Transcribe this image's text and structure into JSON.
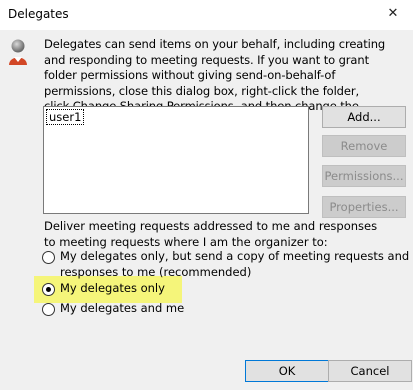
{
  "dialog": {
    "title": "Delegates",
    "close_glyph": "✕"
  },
  "intro_text": "Delegates can send items on your behalf, including creating and responding to meeting requests. If you want to grant folder permissions without giving send-on-behalf-of permissions, close this dialog box, right-click the folder, click Change Sharing Permissions, and then change the options on the Permissions tab.",
  "delegates": [
    "user1"
  ],
  "side_buttons": {
    "add": "Add...",
    "remove": "Remove",
    "permissions": "Permissions...",
    "properties": "Properties..."
  },
  "deliver_label": "Deliver meeting requests addressed to me and responses to meeting requests where I am the organizer to:",
  "options": {
    "opt1_line1": "My delegates only, but send a copy of meeting requests and",
    "opt1_line2": "responses to me (recommended)",
    "opt2": "My delegates only",
    "opt3": "My delegates and me",
    "selected": "My delegates only"
  },
  "footer": {
    "ok": "OK",
    "cancel": "Cancel"
  },
  "icons": {
    "dialog_icon": "delegate-person-icon"
  },
  "colors": {
    "highlight": "#f5f57a",
    "ok_border": "#0078d7"
  }
}
